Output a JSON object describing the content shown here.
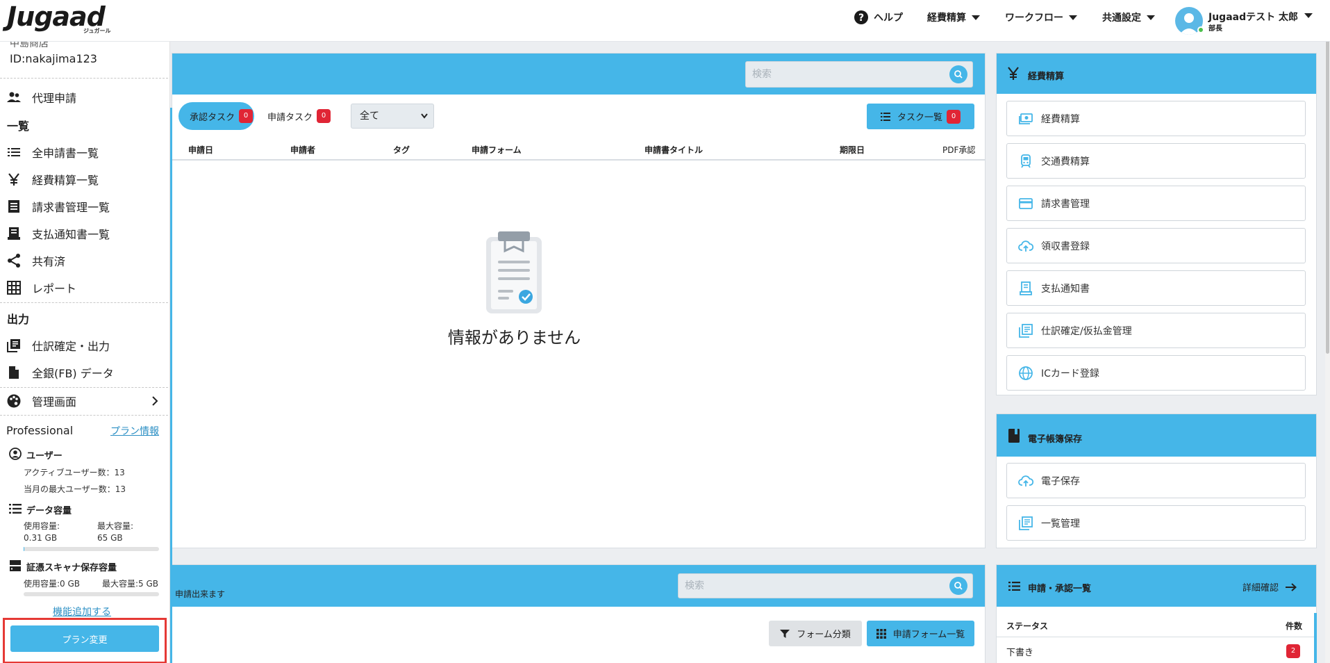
{
  "header": {
    "logo_text": "Jugaad",
    "logo_sub": "ジュガール",
    "nav": [
      {
        "label": "ヘルプ",
        "icon": "help-circle-icon"
      },
      {
        "label": "経費精算",
        "icon": "caret-down-icon"
      },
      {
        "label": "ワークフロー",
        "icon": "caret-down-icon"
      },
      {
        "label": "共通設定",
        "icon": "caret-down-icon"
      }
    ],
    "user": {
      "name": "Jugaadテスト 太郎",
      "role": "部長"
    }
  },
  "sidebar": {
    "cut_text": "中島商店",
    "user_id": "ID:nakajima123",
    "proxy_label": "代理申請",
    "list_heading": "一覧",
    "list_items": [
      {
        "label": "全申請書一覧",
        "icon": "list-icon"
      },
      {
        "label": "経費精算一覧",
        "icon": "yen-icon"
      },
      {
        "label": "請求書管理一覧",
        "icon": "invoice-icon"
      },
      {
        "label": "支払通知書一覧",
        "icon": "receipt-icon"
      },
      {
        "label": "共有済",
        "icon": "share-icon"
      },
      {
        "label": "レポート",
        "icon": "grid-icon"
      }
    ],
    "output_heading": "出力",
    "output_items": [
      {
        "label": "仕訳確定・出力",
        "icon": "library-books-icon"
      },
      {
        "label": "全銀(FB) データ",
        "icon": "file-icon"
      }
    ],
    "admin_label": "管理画面",
    "plan": {
      "name": "Professional",
      "info_link": "プラン情報",
      "users_heading": "ユーザー",
      "active_users": "アクティブユーザー数：13",
      "max_users": "当月の最大ユーザー数：13",
      "data_heading": "データ容量",
      "data_used_label": "使用容量:",
      "data_used": "0.31 GB",
      "data_max_label": "最大容量:",
      "data_max": "65 GB",
      "data_fill": 0.005,
      "scanner_heading": "証憑スキャナ保存容量",
      "scanner_used": "使用容量:0 GB",
      "scanner_max": "最大容量:5 GB",
      "scanner_fill": 0,
      "add_feature": "機能追加する",
      "change_plan": "プラン変更"
    }
  },
  "tasks": {
    "search_placeholder": "検索",
    "approval_tab": {
      "label": "承認タスク",
      "count": "0"
    },
    "request_tab": {
      "label": "申請タスク",
      "count": "0"
    },
    "filter_value": "全て",
    "task_list_button": {
      "label": "タスク一覧",
      "count": "0"
    },
    "columns": [
      "申請日",
      "申請者",
      "タグ",
      "申請フォーム",
      "申請書タイトル",
      "期限日",
      "PDF承認"
    ],
    "empty_message": "情報がありません"
  },
  "forms": {
    "note": "申請出来ます",
    "search_placeholder": "検索",
    "category_button": "フォーム分類",
    "list_button": "申請フォーム一覧"
  },
  "expense_panel": {
    "title": "経費精算",
    "buttons": [
      {
        "label": "経費精算",
        "icon": "money-icon"
      },
      {
        "label": "交通費精算",
        "icon": "train-icon"
      },
      {
        "label": "請求書管理",
        "icon": "credit-card-icon"
      },
      {
        "label": "領収書登録",
        "icon": "cloud-upload-icon"
      },
      {
        "label": "支払通知書",
        "icon": "receipt-icon"
      },
      {
        "label": "仕訳確定/仮払金管理",
        "icon": "library-books-icon"
      },
      {
        "label": "ICカード登録",
        "icon": "globe-icon"
      }
    ]
  },
  "ebook_panel": {
    "title": "電子帳簿保存",
    "buttons": [
      {
        "label": "電子保存",
        "icon": "cloud-upload-icon"
      },
      {
        "label": "一覧管理",
        "icon": "library-books-icon"
      }
    ]
  },
  "status_panel": {
    "title": "申請・承認一覧",
    "detail_link": "詳細確認",
    "col_status": "ステータス",
    "col_count": "件数",
    "rows": [
      {
        "status": "下書き",
        "count": "2"
      }
    ]
  },
  "colors": {
    "accent": "#45b6e8",
    "badge": "#e02535",
    "highlight": "#e53935"
  }
}
